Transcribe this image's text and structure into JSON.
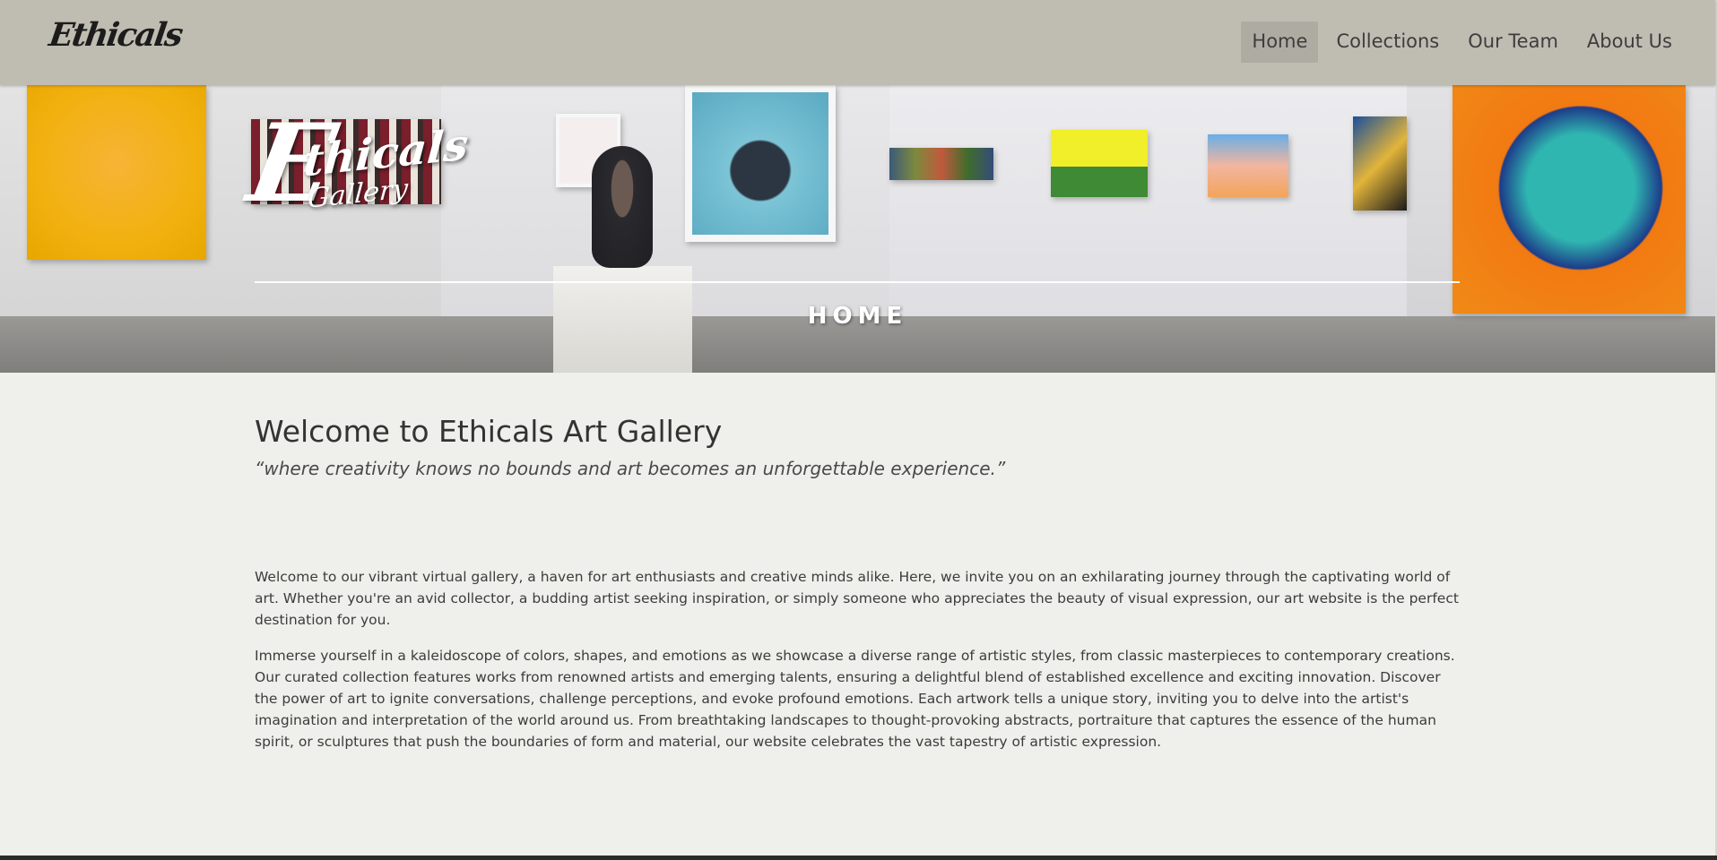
{
  "navbar": {
    "brand": "Ethicals",
    "items": [
      {
        "label": "Home",
        "active": true
      },
      {
        "label": "Collections",
        "active": false
      },
      {
        "label": "Our Team",
        "active": false
      },
      {
        "label": "About Us",
        "active": false
      }
    ]
  },
  "hero": {
    "logo_initial": "E",
    "logo_text": "thicals",
    "logo_sub": "Gallery",
    "title": "HOME"
  },
  "main": {
    "heading": "Welcome to Ethicals Art Gallery",
    "tagline": "“where creativity knows no bounds and art becomes an unforgettable experience.”",
    "paragraphs": [
      "Welcome to our vibrant virtual gallery, a haven for art enthusiasts and creative minds alike. Here, we invite you on an exhilarating journey through the captivating world of art. Whether you're an avid collector, a budding artist seeking inspiration, or simply someone who appreciates the beauty of visual expression, our art website is the perfect destination for you.",
      "Immerse yourself in a kaleidoscope of colors, shapes, and emotions as we showcase a diverse range of artistic styles, from classic masterpieces to contemporary creations. Our curated collection features works from renowned artists and emerging talents, ensuring a delightful blend of established excellence and exciting innovation. Discover the power of art to ignite conversations, challenge perceptions, and evoke profound emotions. Each artwork tells a unique story, inviting you to delve into the artist's imagination and interpretation of the world around us. From breathtaking landscapes to thought-provoking abstracts, portraiture that captures the essence of the human spirit, or sculptures that push the boundaries of form and material, our website celebrates the vast tapestry of artistic expression."
    ]
  },
  "colors": {
    "navbar_bg": "#bfbdb2",
    "nav_active_bg": "#aeaca2",
    "page_bg": "#efefeb",
    "text": "#333333"
  }
}
